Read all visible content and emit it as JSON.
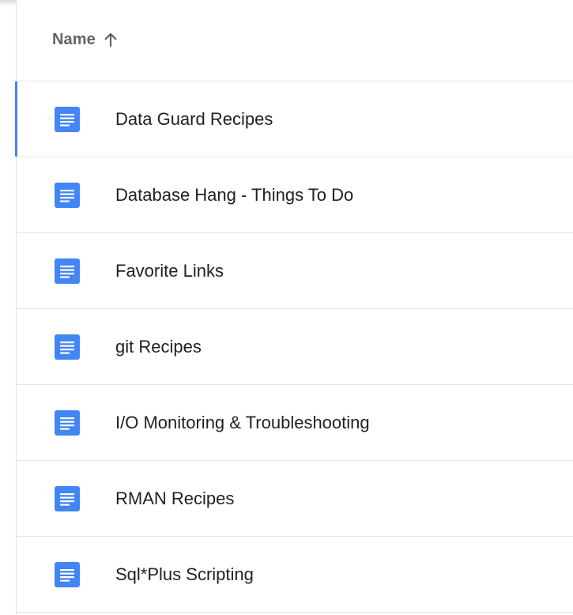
{
  "header": {
    "sort_label": "Name",
    "sort_direction_icon": "arrow-up-icon"
  },
  "files": [
    {
      "name": "Data Guard Recipes",
      "icon": "google-docs-icon",
      "selected": true
    },
    {
      "name": "Database Hang - Things To Do",
      "icon": "google-docs-icon",
      "selected": false
    },
    {
      "name": "Favorite Links",
      "icon": "google-docs-icon",
      "selected": false
    },
    {
      "name": "git Recipes",
      "icon": "google-docs-icon",
      "selected": false
    },
    {
      "name": "I/O Monitoring & Troubleshooting",
      "icon": "google-docs-icon",
      "selected": false
    },
    {
      "name": "RMAN Recipes",
      "icon": "google-docs-icon",
      "selected": false
    },
    {
      "name": "Sql*Plus Scripting",
      "icon": "google-docs-icon",
      "selected": false
    }
  ],
  "colors": {
    "doc_icon_blue": "#4285f4",
    "selection_accent": "#4285f4",
    "header_text": "#5f6368",
    "row_text": "#202124"
  }
}
